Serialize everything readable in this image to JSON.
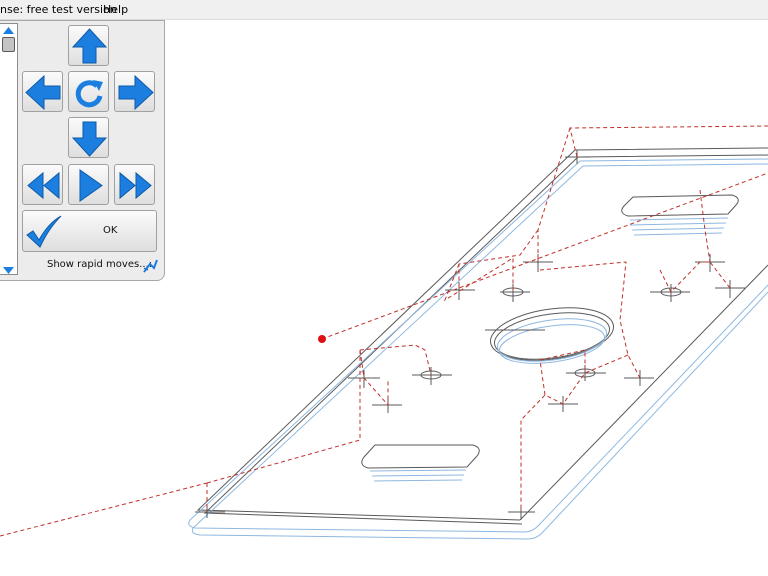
{
  "menubar": {
    "license_label": "nse: free test version",
    "help_label": "Help"
  },
  "panel": {
    "ok_label": "OK",
    "show_rapid_label": "Show rapid moves...:"
  },
  "icons": {
    "up": "arrow-up-icon",
    "left": "arrow-left-icon",
    "rotate": "rotate-icon",
    "right": "arrow-right-icon",
    "down": "arrow-down-icon",
    "rewind": "rewind-icon",
    "play": "play-icon",
    "fast_forward": "fast-forward-icon",
    "ok": "checkmark-icon",
    "rapid": "toolpath-icon"
  },
  "colors": {
    "button_blue": "#1c7fe0",
    "rapid_move": "#c0302b",
    "model_dark": "#555555",
    "model_light": "#8fb8e0",
    "current_position": "#e01010"
  }
}
